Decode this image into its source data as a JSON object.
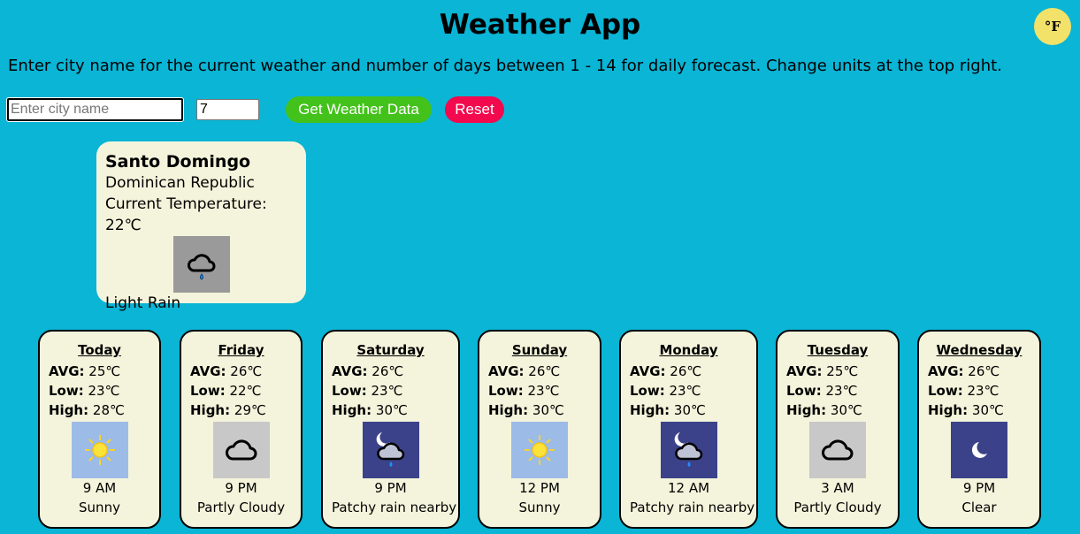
{
  "header": {
    "title": "Weather App",
    "unit_toggle": "°F"
  },
  "instructions": "Enter city name for the current weather and number of days between 1 - 14 for daily forecast. Change units at the top right.",
  "form": {
    "city_placeholder": "Enter city name",
    "city_value": "",
    "days_value": "7",
    "get_label": "Get Weather Data",
    "reset_label": "Reset"
  },
  "current": {
    "city": "Santo Domingo",
    "country": "Dominican Republic",
    "temp_label": "Current Temperature:",
    "temp_value": "22℃",
    "condition": "Light Rain",
    "icon": "cloud-rain-icon"
  },
  "labels": {
    "avg": "AVG:",
    "low": "Low:",
    "high": "High:"
  },
  "forecast": [
    {
      "day": "Today",
      "avg": "25℃",
      "low": "23℃",
      "high": "28℃",
      "time": "9 AM",
      "condition": "Sunny",
      "icon": "sun-icon"
    },
    {
      "day": "Friday",
      "avg": "26℃",
      "low": "22℃",
      "high": "29℃",
      "time": "9 PM",
      "condition": "Partly Cloudy",
      "icon": "cloud-icon"
    },
    {
      "day": "Saturday",
      "avg": "26℃",
      "low": "23℃",
      "high": "30℃",
      "time": "9 PM",
      "condition": "Patchy rain nearby",
      "icon": "moon-cloud-rain-icon"
    },
    {
      "day": "Sunday",
      "avg": "26℃",
      "low": "23℃",
      "high": "30℃",
      "time": "12 PM",
      "condition": "Sunny",
      "icon": "sun-icon"
    },
    {
      "day": "Monday",
      "avg": "26℃",
      "low": "23℃",
      "high": "30℃",
      "time": "12 AM",
      "condition": "Patchy rain nearby",
      "icon": "moon-cloud-rain-icon"
    },
    {
      "day": "Tuesday",
      "avg": "25℃",
      "low": "23℃",
      "high": "30℃",
      "time": "3 AM",
      "condition": "Partly Cloudy",
      "icon": "cloud-icon"
    },
    {
      "day": "Wednesday",
      "avg": "26℃",
      "low": "23℃",
      "high": "30℃",
      "time": "9 PM",
      "condition": "Clear",
      "icon": "moon-icon"
    }
  ],
  "colors": {
    "background": "#0ab5d6",
    "card": "#f4f4dc",
    "get_button": "#44c21c",
    "reset_button": "#f2094e",
    "unit_button": "#f2e26a"
  }
}
